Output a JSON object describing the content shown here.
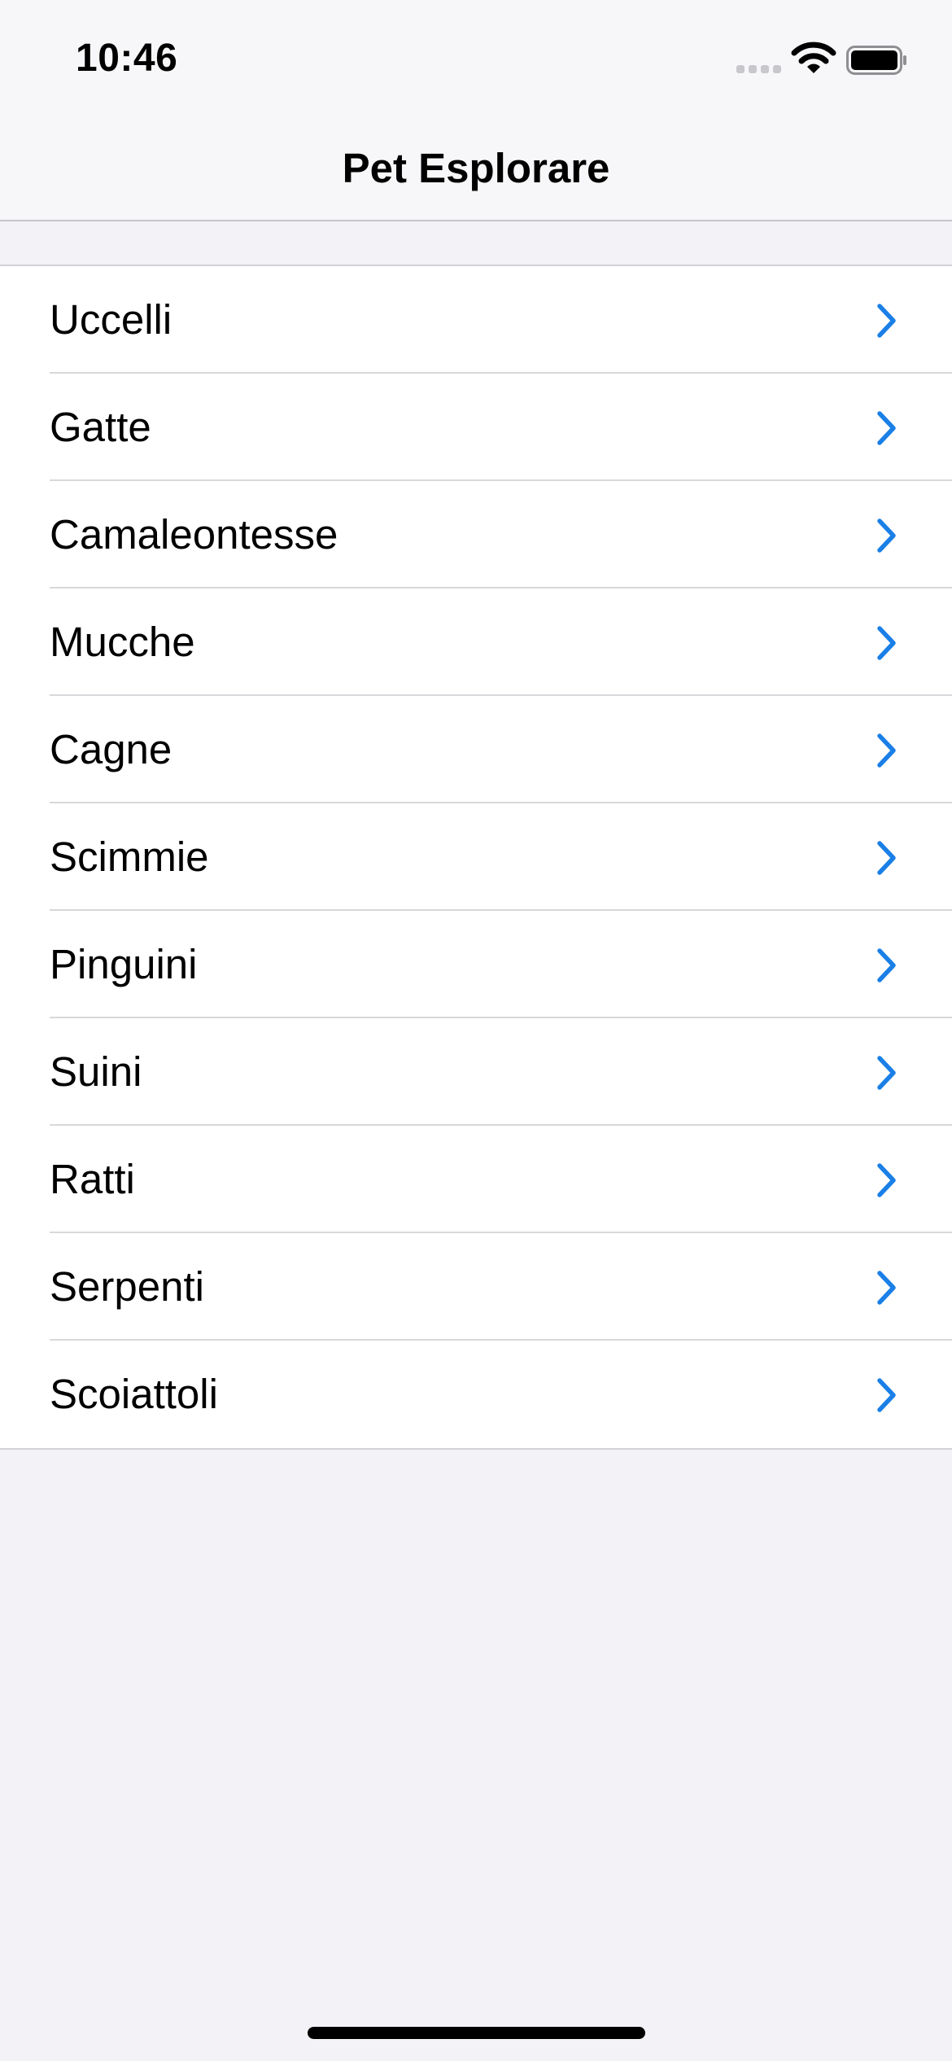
{
  "status_bar": {
    "time": "10:46",
    "icons": [
      "cellular-signal-icon",
      "wifi-icon",
      "battery-icon"
    ]
  },
  "nav": {
    "title": "Pet Esplorare"
  },
  "list": {
    "items": [
      {
        "label": "Uccelli"
      },
      {
        "label": "Gatte"
      },
      {
        "label": "Camaleontesse"
      },
      {
        "label": "Mucche"
      },
      {
        "label": "Cagne"
      },
      {
        "label": "Scimmie"
      },
      {
        "label": "Pinguini"
      },
      {
        "label": "Suini"
      },
      {
        "label": "Ratti"
      },
      {
        "label": "Serpenti"
      },
      {
        "label": "Scoiattoli"
      }
    ],
    "accessory_icon": "chevron-right-icon"
  },
  "colors": {
    "accent": "#1a7fe6",
    "background": "#f2f2f7",
    "cell": "#ffffff"
  }
}
